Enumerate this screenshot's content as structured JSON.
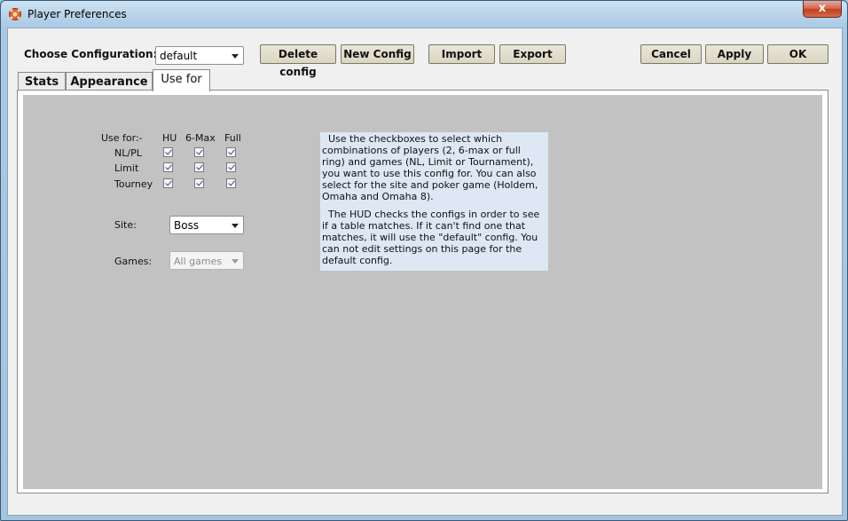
{
  "window": {
    "title": "Player Preferences",
    "close_label": "x"
  },
  "toolbar": {
    "choose_config_label": "Choose Configuration:",
    "config_selected": "default",
    "delete_label": "Delete config",
    "new_label": "New Config",
    "import_label": "Import",
    "export_label": "Export",
    "cancel_label": "Cancel",
    "apply_label": "Apply",
    "ok_label": "OK"
  },
  "tabs": [
    {
      "label": "Stats",
      "active": false
    },
    {
      "label": "Appearance",
      "active": false
    },
    {
      "label": "Use for",
      "active": true
    }
  ],
  "use_for": {
    "header_label": "Use for:-",
    "columns": [
      "HU",
      "6-Max",
      "Full"
    ],
    "rows": [
      {
        "label": "NL/PL",
        "checked": [
          true,
          true,
          true
        ]
      },
      {
        "label": "Limit",
        "checked": [
          true,
          true,
          true
        ]
      },
      {
        "label": "Tourney",
        "checked": [
          true,
          true,
          true
        ]
      }
    ],
    "site_label": "Site:",
    "site_selected": "Boss",
    "games_label": "Games:",
    "games_selected": "All games"
  },
  "help": {
    "paragraph1": "Use the checkboxes to select which combinations of players (2, 6-max or full ring) and games (NL, Limit or Tournament), you want to use this config for. You can also select for the site and poker game (Holdem, Omaha and Omaha 8).",
    "paragraph2": "The HUD checks the configs in order to see if a table matches. If it can't find one that matches, it will use the \"default\" config. You can not edit settings on this page for the default config."
  }
}
